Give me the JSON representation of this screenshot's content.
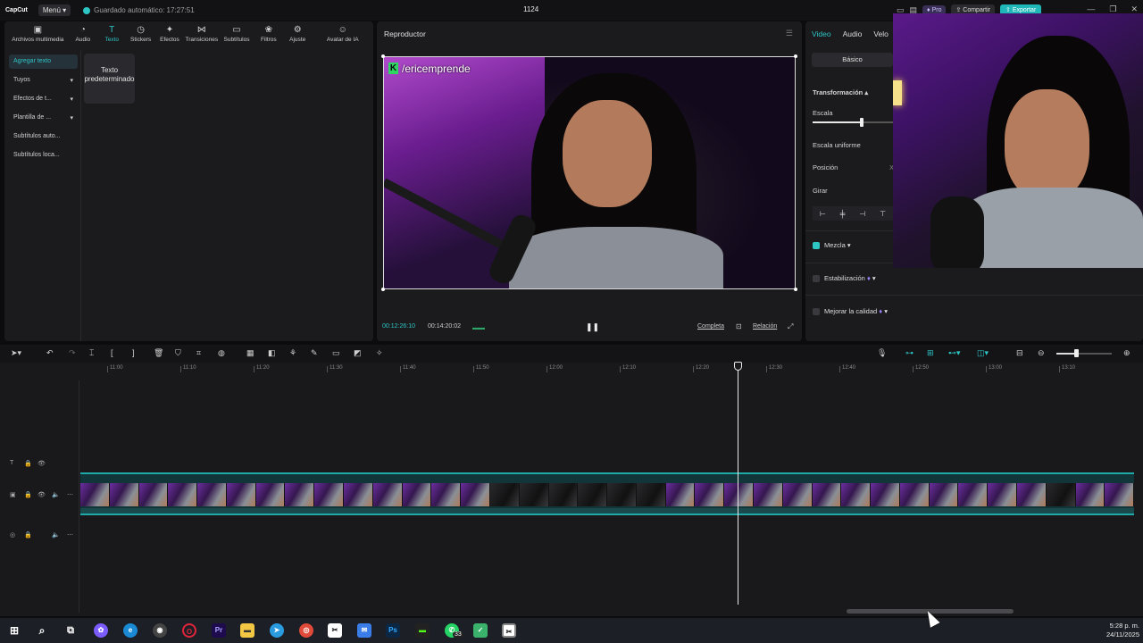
{
  "topbar": {
    "logo": "CapCut",
    "menu_label": "Menú",
    "autosave": "Guardado automático: 17:27:51",
    "project_title": "1124",
    "pro_label": "Pro",
    "share_label": "Compartir",
    "export_label": "Exportar"
  },
  "toolbar_tabs": [
    {
      "label": "Archivos multimedia",
      "icon": "media-icon"
    },
    {
      "label": "Audio",
      "icon": "audio-icon"
    },
    {
      "label": "Texto",
      "icon": "text-icon"
    },
    {
      "label": "Stickers",
      "icon": "sticker-icon"
    },
    {
      "label": "Efectos",
      "icon": "effects-icon"
    },
    {
      "label": "Transiciones",
      "icon": "transition-icon"
    },
    {
      "label": "Subtítulos",
      "icon": "subtitle-icon"
    },
    {
      "label": "Filtros",
      "icon": "filter-icon"
    },
    {
      "label": "Ajuste",
      "icon": "adjust-icon"
    },
    {
      "label": "Avatar de IA",
      "icon": "avatar-icon"
    }
  ],
  "active_tab": "Texto",
  "side_menu": [
    {
      "label": "Agregar texto",
      "active": true
    },
    {
      "label": "Tuyos",
      "active": false
    },
    {
      "label": "Efectos de t...",
      "active": false
    },
    {
      "label": "Plantilla de ...",
      "active": false
    },
    {
      "label": "Subtítulos auto...",
      "active": false
    },
    {
      "label": "Subtítulos loca...",
      "active": false
    }
  ],
  "text_card": {
    "label": "Texto predeterminado"
  },
  "player": {
    "title": "Reproductor",
    "overlay_url": "/ericemprende",
    "current_time": "00:12:26:10",
    "duration": "00:14:20:02",
    "full_label": "Completa",
    "ratio_label": "Relación"
  },
  "properties": {
    "tabs": [
      "Video",
      "Audio",
      "Velo"
    ],
    "active_tab": "Video",
    "basic_label": "Básico",
    "transform_label": "Transformación",
    "scale_label": "Escala",
    "scale_value_fraction": 0.6,
    "uniform_scale_label": "Escala uniforme",
    "position_label": "Posición",
    "position_axis": "X",
    "rotate_label": "Girar",
    "blend_label": "Mezcla",
    "stabilization_label": "Estabilización",
    "enhance_label": "Mejorar la calidad"
  },
  "timeline": {
    "ruler": [
      "11:00",
      "11:10",
      "11:20",
      "11:30",
      "11:40",
      "11:50",
      "12:00",
      "12:10",
      "12:20",
      "12:30",
      "12:40",
      "12:50",
      "13:00",
      "13:10"
    ],
    "zoom_fraction": 0.35
  },
  "taskbar": {
    "time": "5:28 p. m.",
    "date": "24/11/2025",
    "whatsapp_badge": "33"
  },
  "colors": {
    "accent": "#2ec5c5",
    "export": "#1fb7b7",
    "pro": "#3a2f57"
  }
}
